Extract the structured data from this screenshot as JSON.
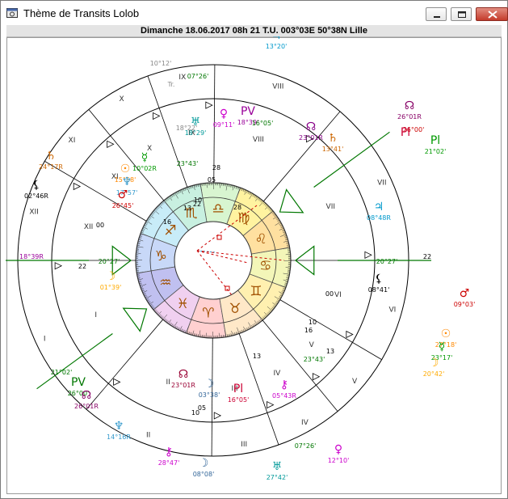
{
  "window": {
    "title": "Thème de Transits  Lolob",
    "header": "Dimanche 18.06.2017 08h 21 T.U. 003°03E 50°38N  Lille",
    "buttons": [
      "minimize",
      "maximize",
      "close"
    ]
  },
  "wheel": {
    "sign_order": [
      "Aries",
      "Taurus",
      "Gemini",
      "Cancer",
      "Leo",
      "Virgo",
      "Libra",
      "Scorpio",
      "Sagittarius",
      "Capricorn",
      "Aquarius",
      "Pisces"
    ],
    "sign_glyphs": [
      "♈",
      "♉",
      "♊",
      "♋",
      "♌",
      "♍",
      "♎",
      "♏",
      "♐",
      "♑",
      "♒",
      "♓"
    ],
    "sign_colors": [
      "#ffd0d0",
      "#ffe8c8",
      "#fff0b0",
      "#f3f6b8",
      "#ffe0a0",
      "#fff3a0",
      "#d8f5d0",
      "#c8f0e0",
      "#c8ecf8",
      "#c8d8f8",
      "#c0c0f0",
      "#f0d0f0"
    ],
    "ascendant_longitude": 290.45,
    "midheaven_longitude": 220.0,
    "colors": {
      "inner_aspect_red": "#cc0000",
      "sign_glyph": "#a05000",
      "house_line": "#000000"
    }
  },
  "natal_house_numbers": [
    "I",
    "II",
    "III",
    "IV",
    "V",
    "VI",
    "VII",
    "VIII",
    "IX",
    "X",
    "XI",
    "XII"
  ],
  "transit_house_numbers": [
    "I",
    "II",
    "III",
    "IV",
    "V",
    "VI",
    "VII",
    "VIII",
    "IX",
    "X",
    "XI",
    "XII"
  ],
  "cusp_degrees": [
    "00",
    "05",
    "10",
    "13",
    "16",
    "22",
    "28",
    "13",
    "10",
    "22",
    "00",
    "05",
    "10",
    "16",
    "22",
    "28",
    "13"
  ],
  "planet_labels": [
    {
      "id": "jupiter-transit-top",
      "glyph": "♃",
      "text": "13°20'",
      "color": "#0099cc"
    },
    {
      "id": "sun-natal-top",
      "glyph": "",
      "text": "07°26'",
      "color": "#007700"
    },
    {
      "id": "moon-tr-gray",
      "glyph": "",
      "text": "10°12'",
      "color": "#888888"
    },
    {
      "id": "tr-label-1",
      "glyph": "",
      "text": "Tr.",
      "color": "#888888"
    },
    {
      "id": "node-natal",
      "glyph": "☊",
      "text": "26°01R",
      "color": "#880066"
    },
    {
      "id": "pluto-natal-sm",
      "glyph": "",
      "text": "26°00'",
      "color": "#cc0000"
    },
    {
      "id": "pl-natal",
      "glyph": "Pl",
      "text": "21°02'",
      "color": "#009900"
    },
    {
      "id": "pl-label",
      "glyph": "Pl",
      "text": "",
      "color": "#cc0033"
    },
    {
      "id": "venus-natal-in",
      "glyph": "♀",
      "text": "09°11'",
      "color": "#cc00cc"
    },
    {
      "id": "node-tr",
      "glyph": "",
      "text": "18°22'",
      "color": "#888888"
    },
    {
      "id": "uranus-inner",
      "glyph": "♅",
      "text": "18°29'",
      "color": "#009999"
    },
    {
      "id": "pv-top",
      "glyph": "PV",
      "text": "18°39'",
      "color": "#990099"
    },
    {
      "id": "pv-top2",
      "glyph": "",
      "text": "16°05'",
      "color": "#007700"
    },
    {
      "id": "node-inner",
      "glyph": "☊",
      "text": "23°01R",
      "color": "#880088"
    },
    {
      "id": "saturn-inner",
      "glyph": "♄",
      "text": "13°41'",
      "color": "#cc6600"
    },
    {
      "id": "saturn-left",
      "glyph": "♄",
      "text": "24°17R",
      "color": "#cc6600"
    },
    {
      "id": "lilith-left",
      "glyph": "⚸",
      "text": "02°46R",
      "color": "#000000"
    },
    {
      "id": "sun-inner-left",
      "glyph": "☉",
      "text": "15°58'",
      "color": "#ff8800"
    },
    {
      "id": "mercury-inner-left",
      "glyph": "☿",
      "text": "10°02R",
      "color": "#009900"
    },
    {
      "id": "neptune-inner-left",
      "glyph": "♆",
      "text": "17°57'",
      "color": "#3399cc"
    },
    {
      "id": "mars-inner-left",
      "glyph": "♂",
      "text": "26°45'",
      "color": "#cc0000"
    },
    {
      "id": "jupiter-right",
      "glyph": "♃",
      "text": "08°48R",
      "color": "#0099cc"
    },
    {
      "id": "pluto-left",
      "glyph": "",
      "text": "18°39R",
      "color": "#990099"
    },
    {
      "id": "moon-left",
      "glyph": "☽",
      "text": "01°39'",
      "color": "#ffaa00"
    },
    {
      "id": "lilith-right",
      "glyph": "⚸",
      "text": "08°41'",
      "color": "#000000"
    },
    {
      "id": "mars-right",
      "glyph": "♂",
      "text": "09°03'",
      "color": "#cc0000"
    },
    {
      "id": "sun-right",
      "glyph": "☉",
      "text": "27°18'",
      "color": "#ff8800"
    },
    {
      "id": "mercury-right",
      "glyph": "☿",
      "text": "23°17'",
      "color": "#009900"
    },
    {
      "id": "moon-right",
      "glyph": "☽",
      "text": "20°42'",
      "color": "#ffaa00"
    },
    {
      "id": "asc-left",
      "glyph": "",
      "text": "20°27'",
      "color": "#007700"
    },
    {
      "id": "asc-right",
      "glyph": "",
      "text": "20°27'",
      "color": "#007700"
    },
    {
      "id": "mc-bottom",
      "glyph": "",
      "text": "23°43'",
      "color": "#007700"
    },
    {
      "id": "mc-top",
      "glyph": "",
      "text": "23°43'",
      "color": "#007700"
    },
    {
      "id": "left-bottom",
      "glyph": "",
      "text": "21°02'",
      "color": "#007700"
    },
    {
      "id": "pv-bottom",
      "glyph": "PV",
      "text": "26°00'",
      "color": "#007700"
    },
    {
      "id": "node-bottom",
      "glyph": "☊",
      "text": "26°01R",
      "color": "#880066"
    },
    {
      "id": "neptune-bottom",
      "glyph": "♆",
      "text": "14°16R",
      "color": "#3399cc"
    },
    {
      "id": "chiron-bottom",
      "glyph": "⚷",
      "text": "28°47'",
      "color": "#cc00cc"
    },
    {
      "id": "moon-bottom",
      "glyph": "☽",
      "text": "08°08'",
      "color": "#336699"
    },
    {
      "id": "uranus-bottom",
      "glyph": "♅",
      "text": "27°42'",
      "color": "#009999"
    },
    {
      "id": "venus-bottom",
      "glyph": "♀",
      "text": "12°10'",
      "color": "#cc00cc"
    },
    {
      "id": "sun-bottom",
      "glyph": "",
      "text": "07°26'",
      "color": "#007700"
    },
    {
      "id": "node-bottom2",
      "glyph": "☊",
      "text": "23°01R",
      "color": "#990033"
    },
    {
      "id": "moon-bottom2",
      "glyph": "☽",
      "text": "03°38'",
      "color": "#336699"
    },
    {
      "id": "pl-bottom",
      "glyph": "Pl",
      "text": "16°05'",
      "color": "#cc0033"
    },
    {
      "id": "chiron-bottom2",
      "glyph": "⚷",
      "text": "05°43R",
      "color": "#cc00cc"
    }
  ]
}
